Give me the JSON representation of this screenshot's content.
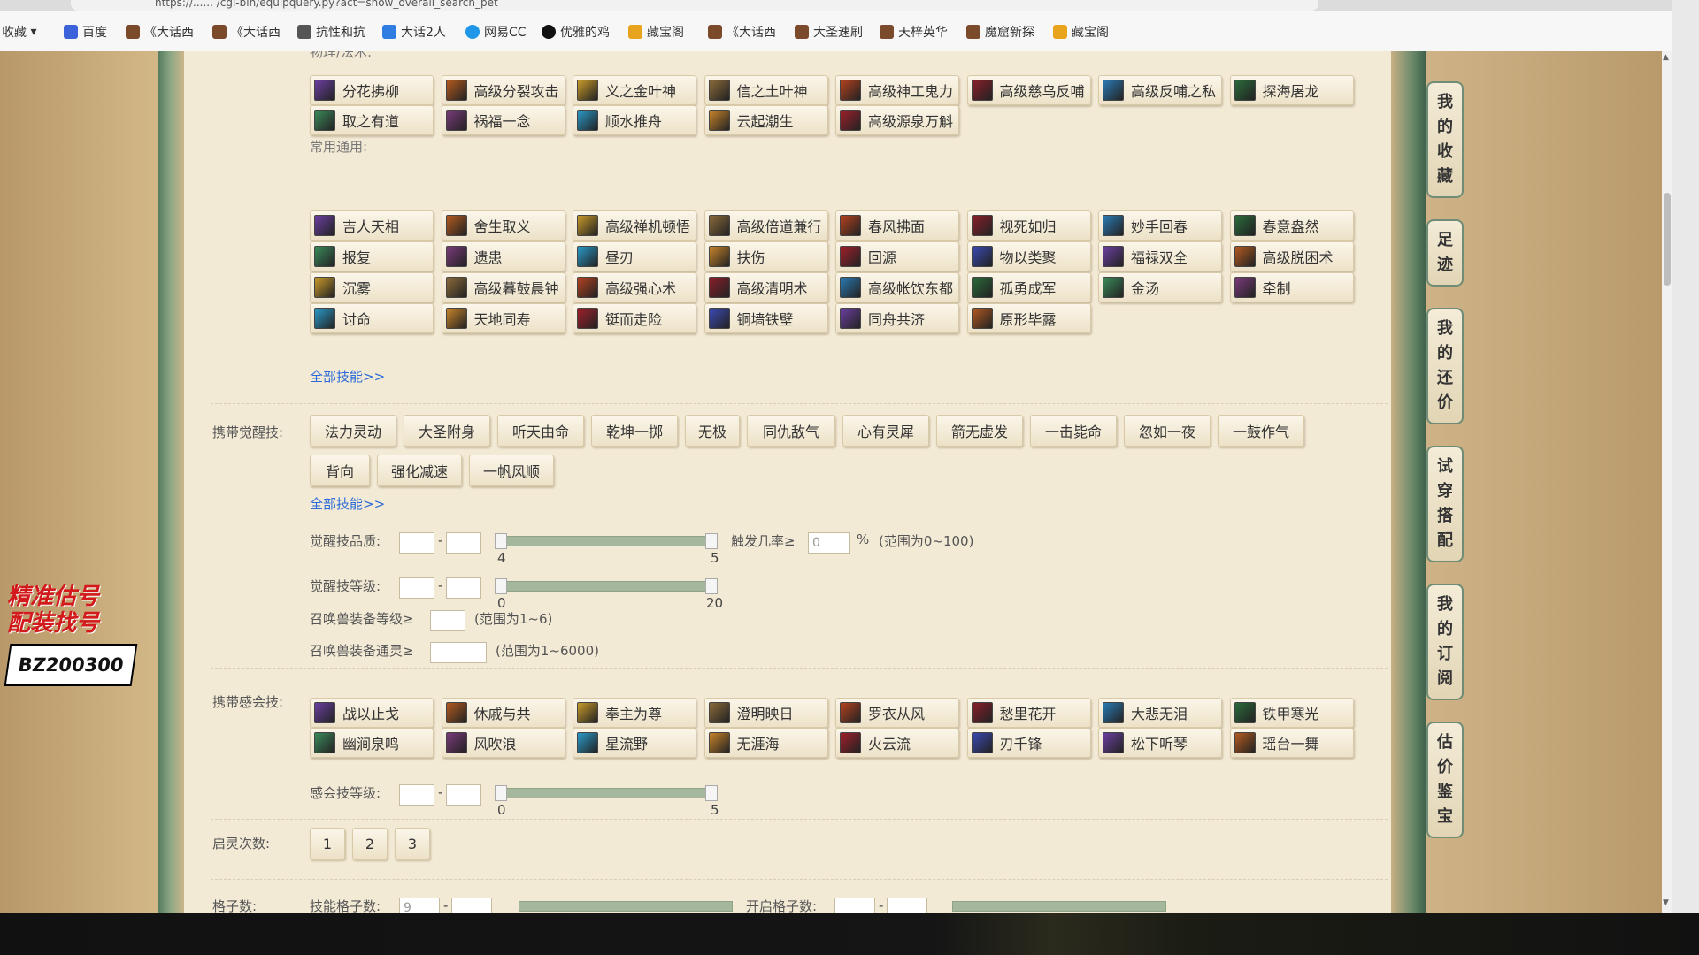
{
  "browser": {
    "url_fragment": "https://...... /cgi-bin/equipquery.py?act=show_overall_search_pet",
    "bookmarks": [
      "收藏",
      "百度",
      "《大话西",
      "《大话西",
      "抗性和抗",
      "大话2人",
      "网易CC",
      "优雅的鸡",
      "藏宝阁",
      "《大话西",
      "大圣速刷",
      "天梓英华",
      "魔窟新探",
      "藏宝阁"
    ]
  },
  "promo": {
    "line1": "精准估号",
    "line2": "配装找号",
    "code": "BZ200300"
  },
  "sidebar": {
    "tabs": [
      {
        "label": "我的收藏"
      },
      {
        "label": "足迹"
      },
      {
        "label": "我的还价"
      },
      {
        "label": "试穿搭配"
      },
      {
        "label": "我的订阅"
      },
      {
        "label": "估价鉴宝"
      }
    ]
  },
  "skills": {
    "section_physical_label": "物理/法术:",
    "physical": [
      "分花拂柳",
      "高级分裂攻击",
      "义之金叶神",
      "信之土叶神",
      "高级神工鬼力",
      "高级慈乌反哺",
      "高级反哺之私",
      "探海屠龙",
      "取之有道",
      "祸福一念",
      "顺水推舟",
      "云起潮生",
      "高级源泉万斛"
    ],
    "section_common_label": "常用通用:",
    "common": [
      "吉人天相",
      "舍生取义",
      "高级禅机顿悟",
      "高级倍道兼行",
      "春风拂面",
      "视死如归",
      "妙手回春",
      "春意盎然",
      "报复",
      "遗患",
      "昼刃",
      "扶伤",
      "回源",
      "物以类聚",
      "福禄双全",
      "高级脱困术",
      "沉雾",
      "高级暮鼓晨钟",
      "高级强心术",
      "高级清明术",
      "高级帐饮东都",
      "孤勇成军",
      "金汤",
      "牵制",
      "讨命",
      "天地同寿",
      "铤而走险",
      "铜墙铁壁",
      "同舟共济",
      "原形毕露"
    ],
    "all_link": "全部技能>>"
  },
  "awaken": {
    "label": "携带觉醒技:",
    "tags": [
      "法力灵动",
      "大圣附身",
      "听天由命",
      "乾坤一掷",
      "无极",
      "同仇敌气",
      "心有灵犀",
      "箭无虚发",
      "一击毙命",
      "忽如一夜",
      "一鼓作气",
      "背向",
      "强化减速",
      "一帆风顺"
    ],
    "all_link": "全部技能>>",
    "quality_label": "觉醒技品质:",
    "quality_min_tick": "4",
    "quality_max_tick": "5",
    "trigger_label": "触发几率≥",
    "trigger_value": "0",
    "trigger_unit": "%",
    "trigger_range": "(范围为0~100)",
    "level_label": "觉醒技等级:",
    "level_min_tick": "0",
    "level_max_tick": "20",
    "equip_level_label": "召唤兽装备等级≥",
    "equip_level_range": "(范围为1~6)",
    "equip_spirit_label": "召唤兽装备通灵≥",
    "equip_spirit_range": "(范围为1~6000)"
  },
  "insight": {
    "label": "携带感会技:",
    "tags": [
      "战以止戈",
      "休戚与共",
      "奉主为尊",
      "澄明映日",
      "罗衣从风",
      "愁里花开",
      "大悲无泪",
      "铁甲寒光",
      "幽涧泉鸣",
      "风吹浪",
      "星流野",
      "无涯海",
      "火云流",
      "刃千锋",
      "松下听琴",
      "瑶台一舞"
    ],
    "level_label": "感会技等级:",
    "level_min_tick": "0",
    "level_max_tick": "5"
  },
  "qiling": {
    "label": "启灵次数:",
    "options": [
      "1",
      "2",
      "3"
    ]
  },
  "grid": {
    "label": "格子数:",
    "skill_grid_label": "技能格子数:",
    "skill_grid_value": "9",
    "open_grid_label": "开启格子数:"
  }
}
